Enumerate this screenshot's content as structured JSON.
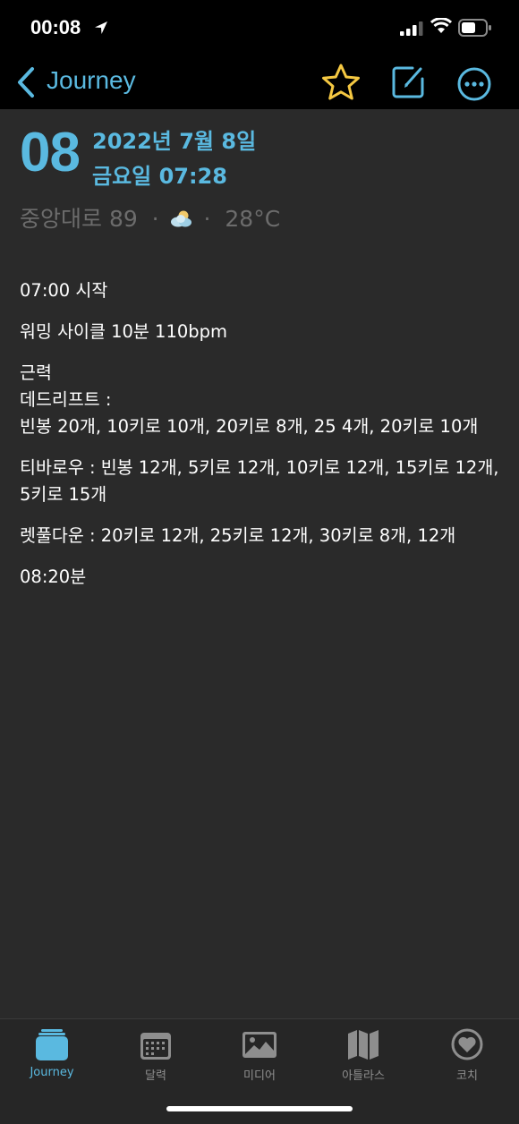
{
  "status_bar": {
    "time": "00:08"
  },
  "nav": {
    "back_label": "Journey",
    "accent_color": "#5ab9e0",
    "star_color": "#f5c842"
  },
  "entry_header": {
    "day": "08",
    "date_line1": "2022년 7월 8일",
    "date_line2": "금요일 07:28",
    "location": "중앙대로 89",
    "temperature": "28°C",
    "weather_icon": "cloud-sun-icon"
  },
  "entry_body": {
    "p1": "07:00 시작",
    "p2": "워밍 사이클 10분 110bpm",
    "p3_l1": "근력",
    "p3_l2": "데드리프트 :",
    "p3_l3": "빈봉 20개, 10키로 10개, 20키로 8개, 25 4개, 20키로 10개",
    "p4": "티바로우 : 빈봉 12개, 5키로 12개, 10키로 12개, 15키로 12개, 5키로 15개",
    "p5": "렛풀다운 : 20키로 12개, 25키로 12개, 30키로 8개, 12개",
    "p6": "08:20분"
  },
  "tab_bar": {
    "tabs": [
      {
        "label": "Journey",
        "icon": "journal-stack-icon",
        "active": true
      },
      {
        "label": "달력",
        "icon": "calendar-icon",
        "active": false
      },
      {
        "label": "미디어",
        "icon": "photo-icon",
        "active": false
      },
      {
        "label": "아틀라스",
        "icon": "map-icon",
        "active": false
      },
      {
        "label": "코치",
        "icon": "heart-icon",
        "active": false
      }
    ]
  }
}
